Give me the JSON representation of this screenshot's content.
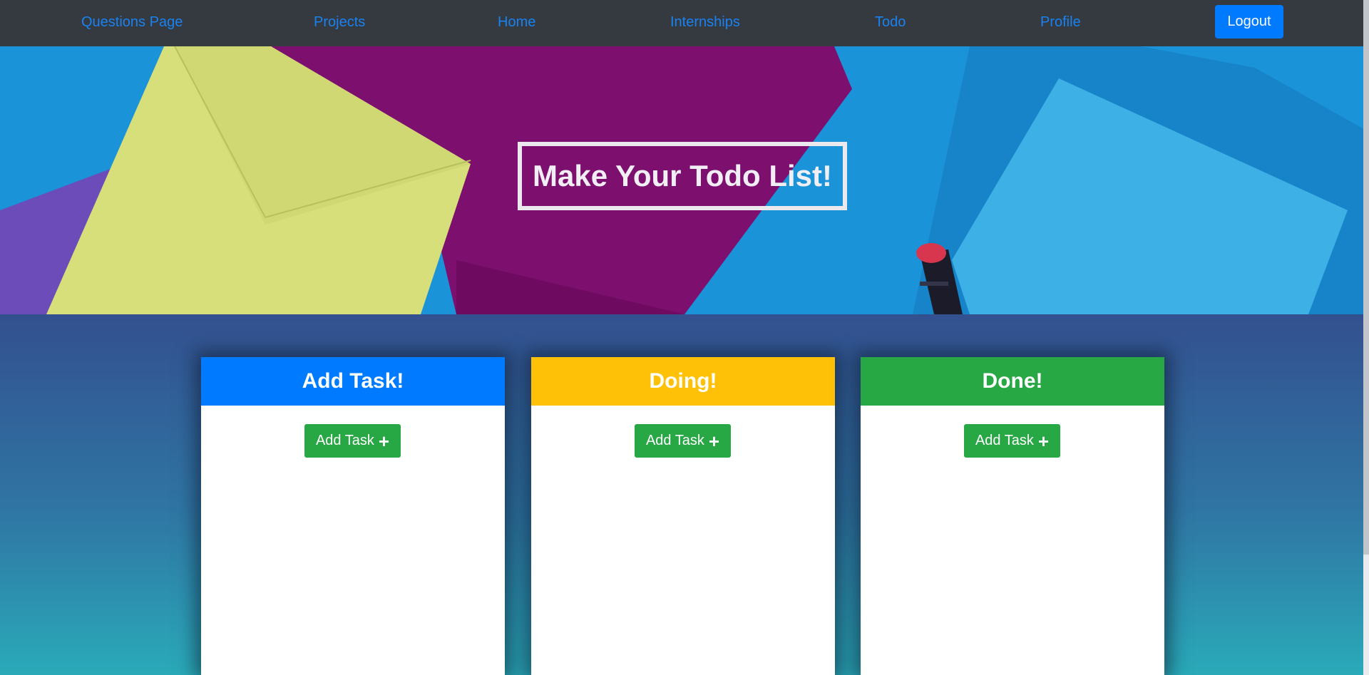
{
  "nav": {
    "links": [
      {
        "label": "Questions Page"
      },
      {
        "label": "Projects"
      },
      {
        "label": "Home"
      },
      {
        "label": "Internships"
      },
      {
        "label": "Todo"
      },
      {
        "label": "Profile"
      }
    ],
    "logout_label": "Logout"
  },
  "hero": {
    "title": "Make Your Todo List!"
  },
  "columns": [
    {
      "title": "Add Task!",
      "color": "#007bff",
      "button_label": "Add Task",
      "button_icon": "plus-icon"
    },
    {
      "title": "Doing!",
      "color": "#ffc107",
      "button_label": "Add Task",
      "button_icon": "plus-icon"
    },
    {
      "title": "Done!",
      "color": "#28a745",
      "button_label": "Add Task",
      "button_icon": "plus-icon"
    }
  ],
  "colors": {
    "navbar": "#343a40",
    "link": "#1a82f0",
    "primary": "#007bff",
    "success": "#28a745",
    "warning": "#ffc107"
  }
}
